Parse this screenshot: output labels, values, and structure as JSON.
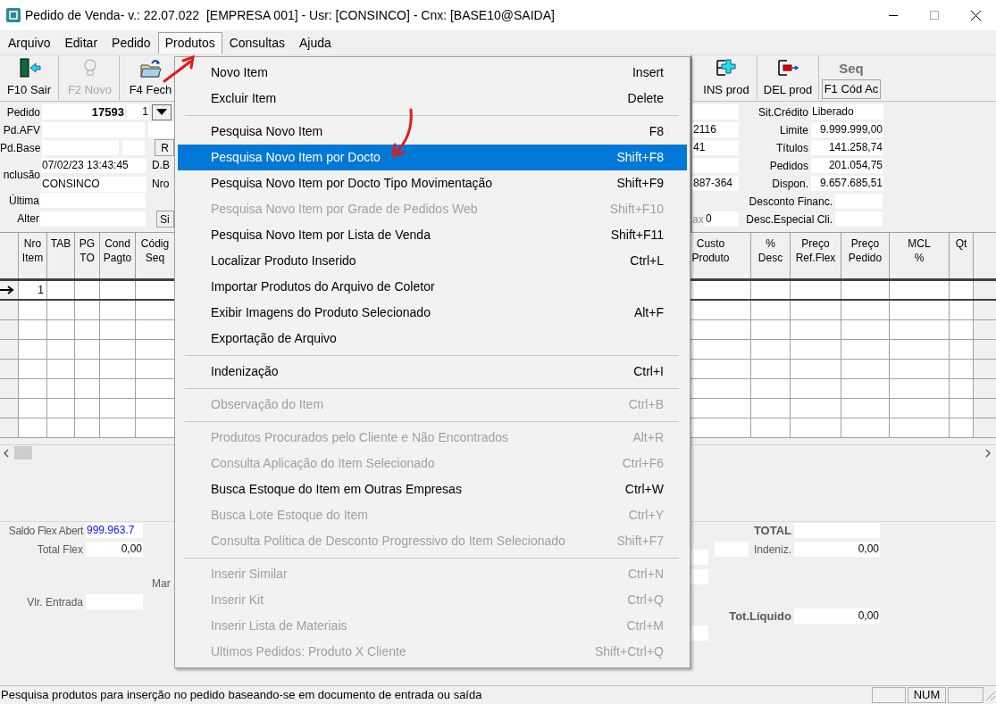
{
  "window": {
    "title": "Pedido de Venda- v.: 22.07.022  [EMPRESA 001] - Usr: [CONSINCO] - Cnx: [BASE10@SAIDA]"
  },
  "menu_bar": [
    {
      "label": "Arquivo",
      "selected": false
    },
    {
      "label": "Editar",
      "selected": false
    },
    {
      "label": "Pedido",
      "selected": false
    },
    {
      "label": "Produtos",
      "selected": true
    },
    {
      "label": "Consultas",
      "selected": false
    },
    {
      "label": "Ajuda",
      "selected": false
    }
  ],
  "toolbar_left": [
    {
      "kind": "exit",
      "label": "F10 Sair",
      "disabled": false
    },
    {
      "kind": "bulb",
      "label": "F2 Novo",
      "disabled": true
    },
    {
      "kind": "folder",
      "label": "F4 Fech",
      "disabled": false
    }
  ],
  "toolbar_right": [
    {
      "kind": "insert",
      "label": "INS prod"
    },
    {
      "kind": "delete",
      "label": "DEL prod"
    },
    {
      "kind": "caption",
      "caption": "Seq",
      "label": "F1 Cód Ac"
    }
  ],
  "header_left": {
    "pedido": {
      "label": "Pedido",
      "number": "17593",
      "sequence": "1"
    },
    "pd_afv": {
      "label": "Pd.AFV"
    },
    "pd_base": {
      "label": "Pd.Base",
      "button": "R"
    },
    "inclusao": {
      "label": "nclusão",
      "date": "07/02/23 13:43:45",
      "user": "CONSINCO",
      "side_labels": [
        "D.B",
        "Nro"
      ]
    },
    "ultima_alter": {
      "labels": [
        "Última",
        "Alter"
      ],
      "button": "Si"
    }
  },
  "header_right": [
    {
      "label": "Sit.Crédito",
      "value": "Liberado"
    },
    {
      "column_1": "2116",
      "label": "Limite",
      "value": "9.999.999,00"
    },
    {
      "column_1": "41",
      "label": "Títulos",
      "value": "141.258,74"
    },
    {
      "label": "Pedidos",
      "value": "201.054,75"
    },
    {
      "column_1": "887-364",
      "label": "Dispon.",
      "value": "9.657.685,51"
    },
    {
      "kind": "wide",
      "label": "Desconto Financ."
    },
    {
      "kind": "wide",
      "side_label": "ax",
      "column_1": "0",
      "label": "Desc.Especial Cli."
    }
  ],
  "grid": {
    "columns_left": [
      {
        "lines": [
          "Nro",
          "Item"
        ]
      },
      {
        "lines": [
          "TAB"
        ]
      },
      {
        "lines": [
          "PG",
          "TO"
        ]
      },
      {
        "lines": [
          "Cond",
          "Pagto"
        ]
      },
      {
        "lines": [
          "Códig",
          "Seq"
        ]
      }
    ],
    "columns_right": [
      {
        "lines": [
          "Custo",
          "Produto"
        ]
      },
      {
        "lines": [
          "%",
          "Desc"
        ]
      },
      {
        "lines": [
          "Preço",
          "Ref.Flex"
        ]
      },
      {
        "lines": [
          "Preço",
          "Pedido"
        ]
      },
      {
        "lines": [
          "MCL",
          "%"
        ]
      },
      {
        "lines": [
          "Qt"
        ]
      }
    ],
    "rows": [
      {
        "nro_item": "1",
        "current": true
      }
    ]
  },
  "footer_left": {
    "saldo_flex": {
      "label": "Saldo Flex Abert",
      "value": "999.963.7"
    },
    "total_flex": {
      "label": "Total Flex",
      "value": "0,00"
    },
    "mar_label": "Mar",
    "vlr_entrada": {
      "label": "Vlr. Entrada"
    }
  },
  "footer_right": {
    "total": {
      "label": "TOTAL"
    },
    "indeniz": {
      "label": "Indeniz.",
      "value": "0,00"
    },
    "tot_liquido": {
      "label": "Tot.Líquido",
      "value": "0,00"
    }
  },
  "status_bar": {
    "message": "Pesquisa produtos para inserção no pedido baseando-se em documento de entrada ou saída",
    "num_indicator": "NUM"
  },
  "dropdown": {
    "items": [
      {
        "kind": "item",
        "label": "Novo Item",
        "shortcut": "Insert",
        "disabled": false,
        "selected": false
      },
      {
        "kind": "item",
        "label": "Excluir Item",
        "shortcut": "Delete",
        "disabled": false,
        "selected": false
      },
      {
        "kind": "separator"
      },
      {
        "kind": "item",
        "label": "Pesquisa Novo Item",
        "shortcut": "F8",
        "disabled": false,
        "selected": false
      },
      {
        "kind": "item",
        "label": "Pesquisa Novo Item por Docto",
        "shortcut": "Shift+F8",
        "disabled": false,
        "selected": true
      },
      {
        "kind": "item",
        "label": "Pesquisa Novo Item por Docto Tipo Movimentação",
        "shortcut": "Shift+F9",
        "disabled": false,
        "selected": false
      },
      {
        "kind": "item",
        "label": "Pesquisa Novo Item por Grade de Pedidos Web",
        "shortcut": "Shift+F10",
        "disabled": true,
        "selected": false
      },
      {
        "kind": "item",
        "label": "Pesquisa Novo Item por Lista de Venda",
        "shortcut": "Shift+F11",
        "disabled": false,
        "selected": false
      },
      {
        "kind": "item",
        "label": "Localizar Produto Inserido",
        "shortcut": "Ctrl+L",
        "disabled": false,
        "selected": false
      },
      {
        "kind": "item",
        "label": "Importar Produtos do Arquivo de Coletor",
        "disabled": false,
        "selected": false
      },
      {
        "kind": "item",
        "label": "Exibir Imagens do Produto Selecionado",
        "shortcut": "Alt+F",
        "disabled": false,
        "selected": false
      },
      {
        "kind": "item",
        "label": "Exportação de Arquivo",
        "disabled": false,
        "selected": false
      },
      {
        "kind": "separator"
      },
      {
        "kind": "item",
        "label": "Indenização",
        "shortcut": "Ctrl+I",
        "disabled": false,
        "selected": false
      },
      {
        "kind": "separator"
      },
      {
        "kind": "item",
        "label": "Observação do Item",
        "shortcut": "Ctrl+B",
        "disabled": true,
        "selected": false
      },
      {
        "kind": "separator"
      },
      {
        "kind": "item",
        "label": "Produtos Procurados pelo Cliente e Não Encontrados",
        "shortcut": "Alt+R",
        "disabled": true,
        "selected": false
      },
      {
        "kind": "item",
        "label": "Consulta Aplicação do Item Selecionado",
        "shortcut": "Ctrl+F6",
        "disabled": true,
        "selected": false
      },
      {
        "kind": "item",
        "label": "Busca Estoque do Item em Outras Empresas",
        "shortcut": "Ctrl+W",
        "disabled": false,
        "selected": false
      },
      {
        "kind": "item",
        "label": "Busca Lote Estoque do Item",
        "shortcut": "Ctrl+Y",
        "disabled": true,
        "selected": false
      },
      {
        "kind": "item",
        "label": "Consulta Política de Desconto Progressivo do Item Selecionado",
        "shortcut": "Shift+F7",
        "disabled": true,
        "selected": false
      },
      {
        "kind": "separator"
      },
      {
        "kind": "item",
        "label": "Inserir Similar",
        "shortcut": "Ctrl+N",
        "disabled": true,
        "selected": false
      },
      {
        "kind": "item",
        "label": "Inserir Kit",
        "shortcut": "Ctrl+Q",
        "disabled": true,
        "selected": false
      },
      {
        "kind": "item",
        "label": "Inserir Lista de Materiais",
        "shortcut": "Ctrl+M",
        "disabled": true,
        "selected": false
      },
      {
        "kind": "item",
        "label": "Ultimos Pedidos: Produto X Cliente",
        "shortcut": "Shift+Ctrl+Q",
        "disabled": true,
        "selected": false
      }
    ]
  }
}
